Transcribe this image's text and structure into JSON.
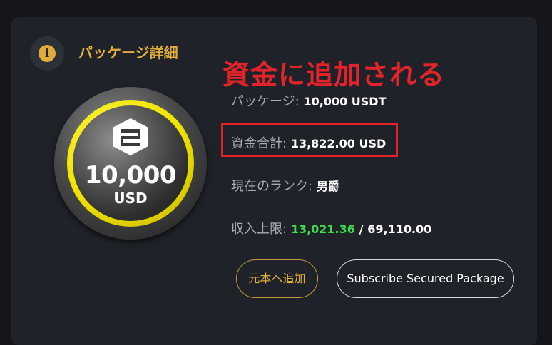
{
  "header": {
    "title": "パッケージ詳細",
    "icon": "info-icon"
  },
  "annotation": {
    "text": "資金に追加される",
    "color": "#e2242a"
  },
  "coin": {
    "amount": "10,000",
    "unit": "USD",
    "logo": "hexagon-e-logo-icon"
  },
  "details": {
    "package_label": "パッケージ:",
    "package_value": "10,000 USDT",
    "total_label": "資金合計:",
    "total_value": "13,822.00 USD",
    "rank_label": "現在のランク:",
    "rank_value": "男爵",
    "income_label": "収入上限:",
    "income_current": "13,021.36",
    "income_separator": "/",
    "income_max": "69,110.00"
  },
  "buttons": {
    "add_principal": "元本へ追加",
    "subscribe": "Subscribe Secured Package"
  },
  "colors": {
    "accent": "#e0ac3a",
    "highlight": "#e2242a",
    "income_green": "#3ddc4a",
    "card_bg": "#1f2229",
    "page_bg": "#14161c"
  }
}
